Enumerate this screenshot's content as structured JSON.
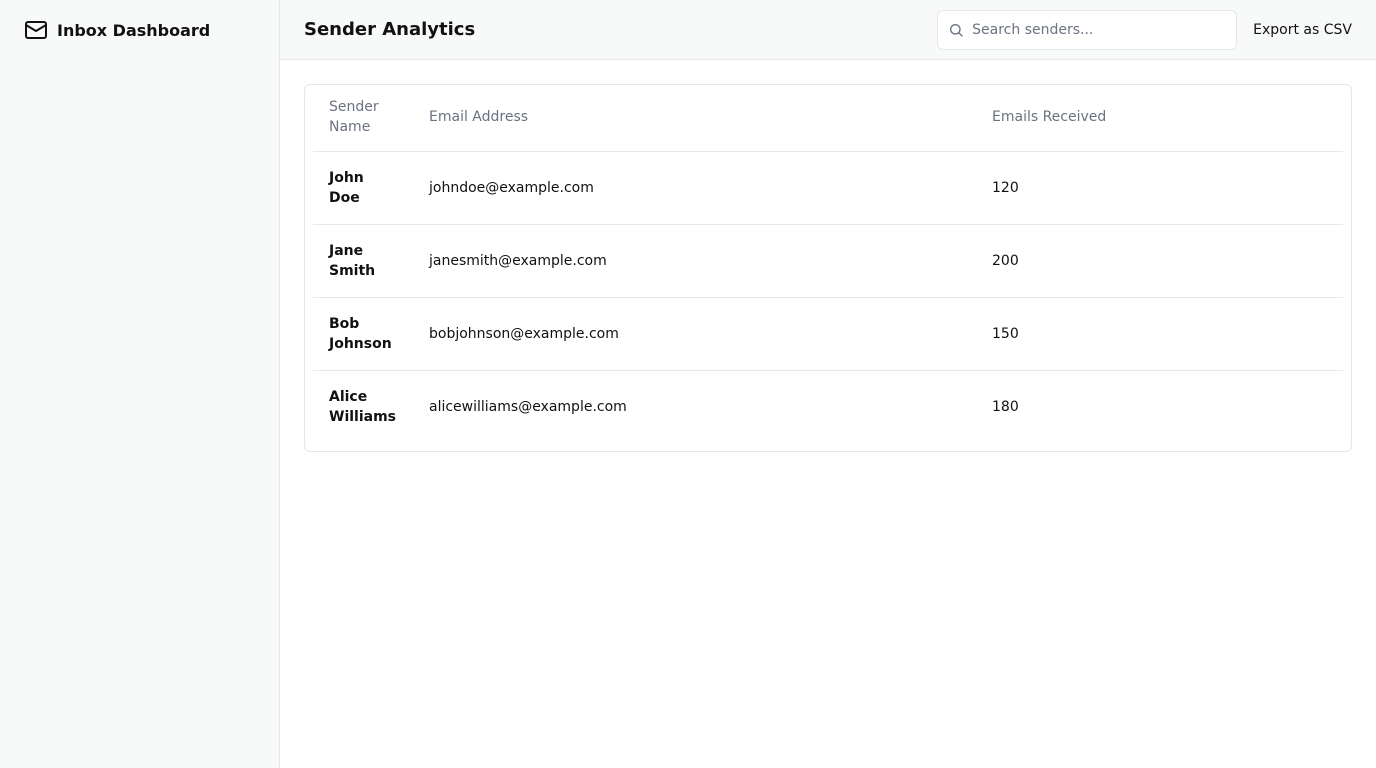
{
  "sidebar": {
    "brand": {
      "icon": "mail-icon",
      "title": "Inbox Dashboard"
    }
  },
  "header": {
    "title": "Sender Analytics",
    "search": {
      "icon": "search-icon",
      "placeholder": "Search senders...",
      "value": ""
    },
    "export_label": "Export as CSV"
  },
  "table": {
    "columns": [
      "Sender Name",
      "Email Address",
      "Emails Received"
    ],
    "rows": [
      {
        "name": "John Doe",
        "email": "johndoe@example.com",
        "count": "120"
      },
      {
        "name": "Jane Smith",
        "email": "janesmith@example.com",
        "count": "200"
      },
      {
        "name": "Bob Johnson",
        "email": "bobjohnson@example.com",
        "count": "150"
      },
      {
        "name": "Alice Williams",
        "email": "alicewilliams@example.com",
        "count": "180"
      }
    ]
  },
  "colors": {
    "sidebar_bg": "#f8faf9",
    "border": "#e5e7eb",
    "muted_text": "#6b7280",
    "text": "#111111"
  }
}
